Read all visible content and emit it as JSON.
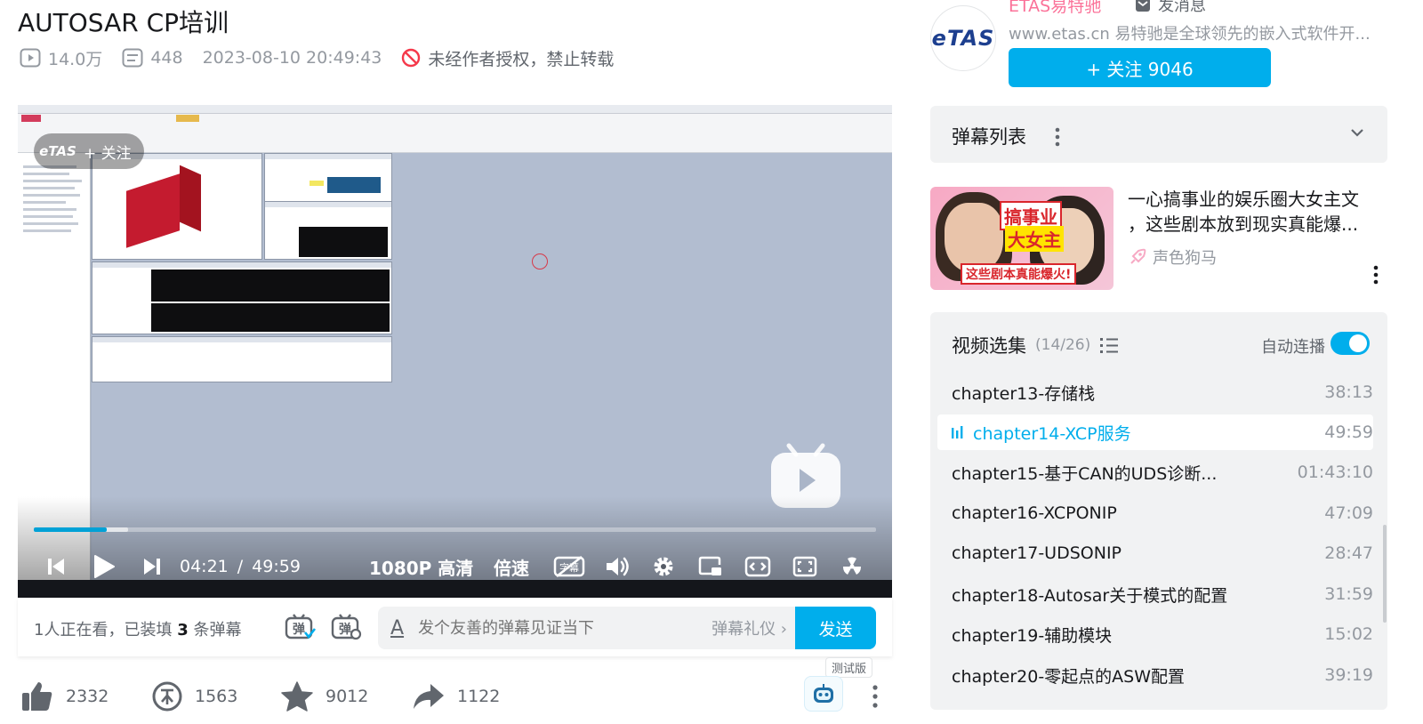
{
  "video": {
    "title": "AUTOSAR CP培训",
    "views": "14.0万",
    "danmaku_count": "448",
    "publish_time": "2023-08-10 20:49:43",
    "copyright_notice": "未经作者授权，禁止转载"
  },
  "player": {
    "overlay_logo": "eTAS",
    "overlay_follow": "+ 关注",
    "help": "?",
    "current_time": "04:21",
    "time_sep": "/",
    "duration": "49:59",
    "progress": 0.087,
    "buffered": 0.112,
    "quality": "1080P 高清",
    "speed": "倍速",
    "subtitle_label": "字幕"
  },
  "danmaku_bar": {
    "viewers_prefix": "1人正在看，已装填",
    "loaded_count": "3",
    "loaded_suffix": "条弹幕",
    "toggle1": "弹",
    "toggle2": "弹",
    "input_icon": "A",
    "input_placeholder": "发个友善的弹幕见证当下",
    "gift_label": "弹幕礼仪 ›",
    "send_label": "发送"
  },
  "toolbar": {
    "likes": "2332",
    "coins": "1563",
    "favorites": "9012",
    "shares": "1122",
    "test_tag": "测试版"
  },
  "uploader": {
    "avatar_text": "eTAS",
    "name": "ETAS易特驰",
    "message_label": "发消息",
    "description": "www.etas.cn 易特驰是全球领先的嵌入式软件开...",
    "follow_label": "+ 关注 9046"
  },
  "danmaku_list": {
    "label": "弹幕列表"
  },
  "ad": {
    "caption1": "搞事业",
    "caption2": "大女主",
    "caption3": "这些剧本真能爆火!",
    "title_line1": "一心搞事业的娱乐圈大女主文",
    "title_line2": "，这些剧本放到现实真能爆...",
    "author": "声色狗马"
  },
  "playlist": {
    "title": "视频选集",
    "count": "(14/26)",
    "autoplay_label": "自动连播",
    "autoplay_on": true,
    "episodes": [
      {
        "title": "chapter13-存储栈",
        "duration": "38:13"
      },
      {
        "title": "chapter14-XCP服务",
        "duration": "49:59"
      },
      {
        "title": "chapter15-基于CAN的UDS诊断...",
        "duration": "01:43:10"
      },
      {
        "title": "chapter16-XCPONIP",
        "duration": "47:09"
      },
      {
        "title": "chapter17-UDSONIP",
        "duration": "28:47"
      },
      {
        "title": "chapter18-Autosar关于模式的配置",
        "duration": "31:59"
      },
      {
        "title": "chapter19-辅助模块",
        "duration": "15:02"
      },
      {
        "title": "chapter20-零起点的ASW配置",
        "duration": "39:19"
      }
    ]
  },
  "colors": {
    "brand_blue": "#00aeec",
    "progress_blue": "#00a1d6",
    "pink": "#fb7299",
    "text_gray": "#9499a0"
  }
}
